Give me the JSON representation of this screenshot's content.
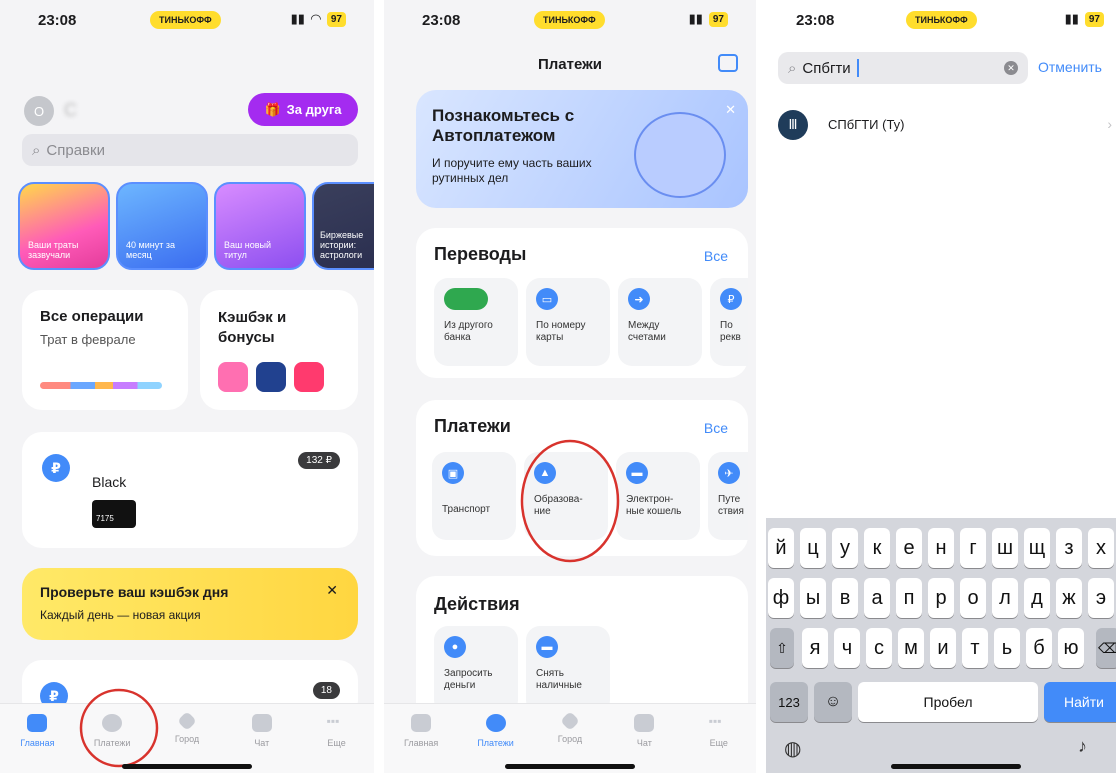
{
  "status": {
    "time": "23:08",
    "bank_badge": "ТИНЬКОФФ",
    "battery": "97"
  },
  "screen1": {
    "avatar_letter": "О",
    "user_name": "С",
    "invite_button": "За друга",
    "search_placeholder": "Справки",
    "stories": [
      "Ваши траты зазвучали",
      "40 минут за месяц",
      "Ваш новый титул",
      "Биржевые истории: астрологи"
    ],
    "ops_title": "Все операции",
    "ops_sub": "Трат в феврале",
    "cashback_title": "Кэшбэк и бонусы",
    "account_name": "Black",
    "account_badge": "132 ₽",
    "card_number": "7175",
    "promo_title": "Проверьте ваш кэшбэк дня",
    "promo_sub": "Каждый день — новая акция",
    "bottom_badge": "18"
  },
  "tabs": [
    "Главная",
    "Платежи",
    "Город",
    "Чат",
    "Еще"
  ],
  "screen2": {
    "title": "Платежи",
    "banner_title": "Познакомьтесь с Автоплатежом",
    "banner_sub": "И поручите ему часть ваших рутинных дел",
    "transfers_title": "Переводы",
    "all_label": "Все",
    "transfers": [
      "Из другого банка",
      "По номеру карты",
      "Между счетами",
      "По рекв"
    ],
    "payments_title": "Платежи",
    "payments": [
      "Транспорт",
      "Образова-ние",
      "Электрон-ные кошель",
      "Путе ствия"
    ],
    "actions_title": "Действия",
    "actions": [
      "Запросить деньги",
      "Снять наличные"
    ]
  },
  "screen3": {
    "search_value": "Спбгти",
    "cancel": "Отменить",
    "result": "СПбГТИ (Ту)",
    "keyboard": {
      "row1": [
        "й",
        "ц",
        "у",
        "к",
        "е",
        "н",
        "г",
        "ш",
        "щ",
        "з",
        "х"
      ],
      "row2": [
        "ф",
        "ы",
        "в",
        "а",
        "п",
        "р",
        "о",
        "л",
        "д",
        "ж",
        "э"
      ],
      "row3": [
        "я",
        "ч",
        "с",
        "м",
        "и",
        "т",
        "ь",
        "б",
        "ю"
      ],
      "num": "123",
      "space": "Пробел",
      "go": "Найти"
    }
  },
  "colors": {
    "accent": "#428bf9",
    "brand_yellow": "#ffdd2d",
    "purple": "#a42bf0"
  }
}
